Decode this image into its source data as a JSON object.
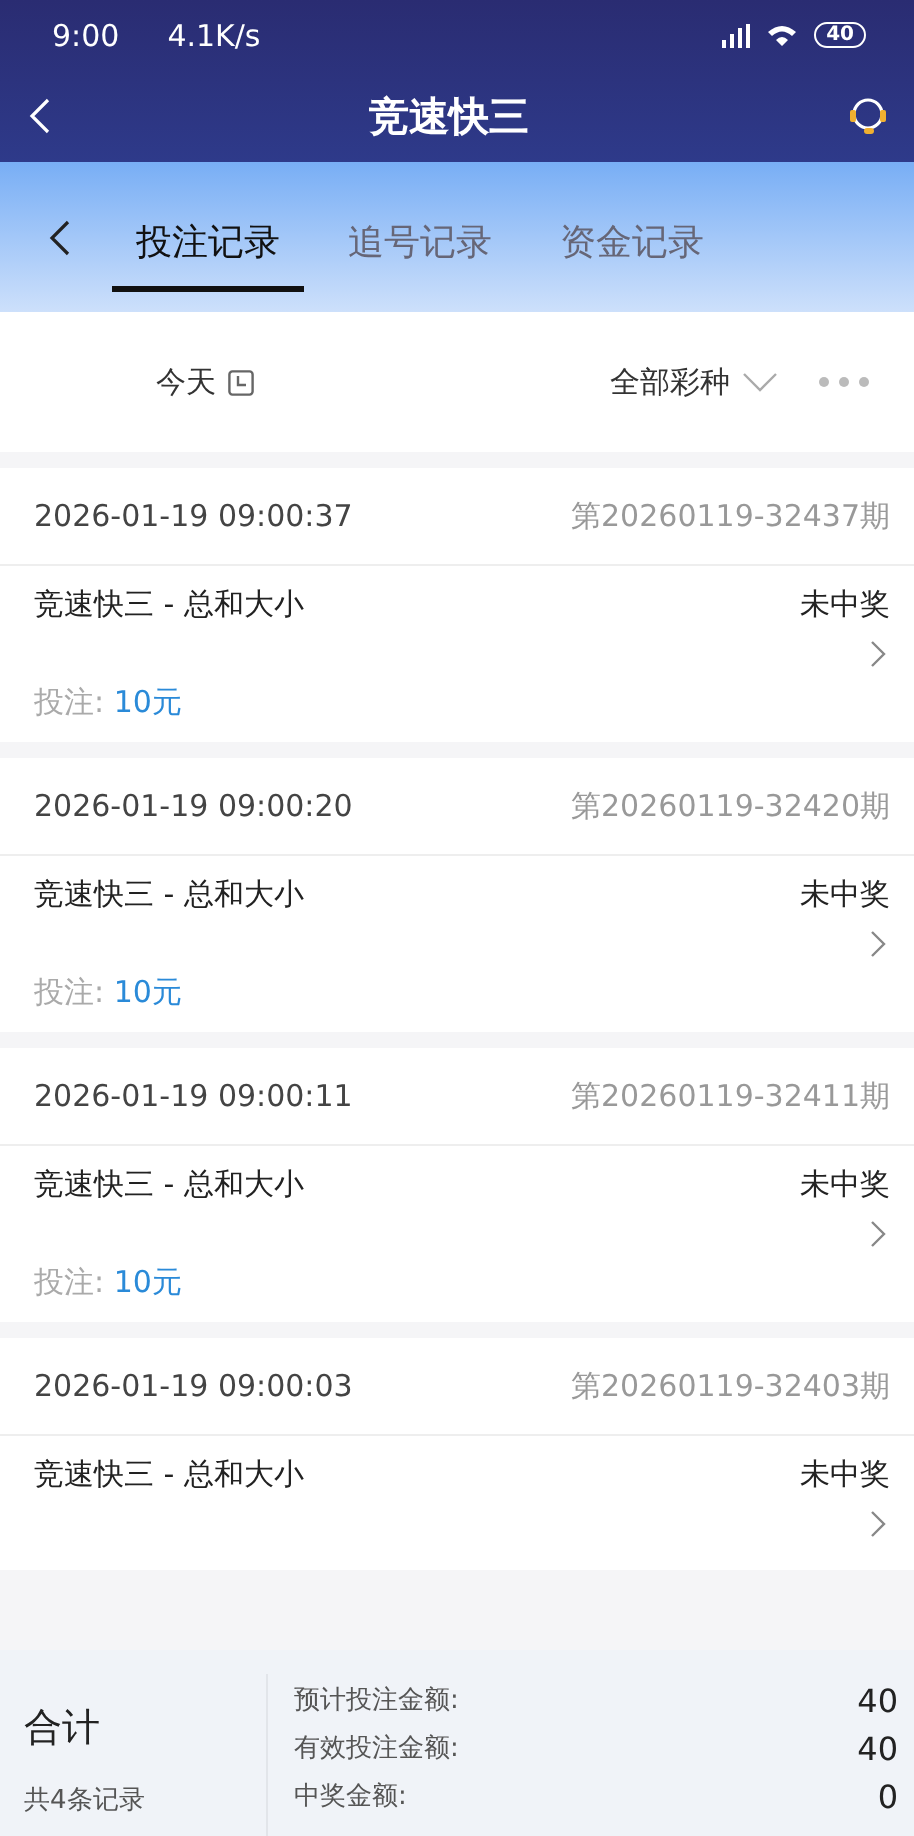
{
  "status_bar": {
    "time": "9:00",
    "speed": "4.1K/s",
    "battery": "40"
  },
  "header": {
    "title": "竞速快三"
  },
  "tabs": [
    {
      "label": "投注记录",
      "selected": true
    },
    {
      "label": "追号记录",
      "selected": false
    },
    {
      "label": "资金记录",
      "selected": false
    }
  ],
  "filters": {
    "date": "今天",
    "lottery": "全部彩种"
  },
  "records": [
    {
      "time": "2026-01-19 09:00:37",
      "issue": "第20260119-32437期",
      "game": "竞速快三 - 总和大小",
      "result": "未中奖",
      "bet_label": "投注:",
      "bet_amount": "10元"
    },
    {
      "time": "2026-01-19 09:00:20",
      "issue": "第20260119-32420期",
      "game": "竞速快三 - 总和大小",
      "result": "未中奖",
      "bet_label": "投注:",
      "bet_amount": "10元"
    },
    {
      "time": "2026-01-19 09:00:11",
      "issue": "第20260119-32411期",
      "game": "竞速快三 - 总和大小",
      "result": "未中奖",
      "bet_label": "投注:",
      "bet_amount": "10元"
    },
    {
      "time": "2026-01-19 09:00:03",
      "issue": "第20260119-32403期",
      "game": "竞速快三 - 总和大小",
      "result": "未中奖"
    }
  ],
  "summary": {
    "title": "合计",
    "count": "共4条记录",
    "rows": [
      {
        "label": "预计投注金额:",
        "value": "40"
      },
      {
        "label": "有效投注金额:",
        "value": "40"
      },
      {
        "label": "中奖金额:",
        "value": "0"
      }
    ]
  }
}
